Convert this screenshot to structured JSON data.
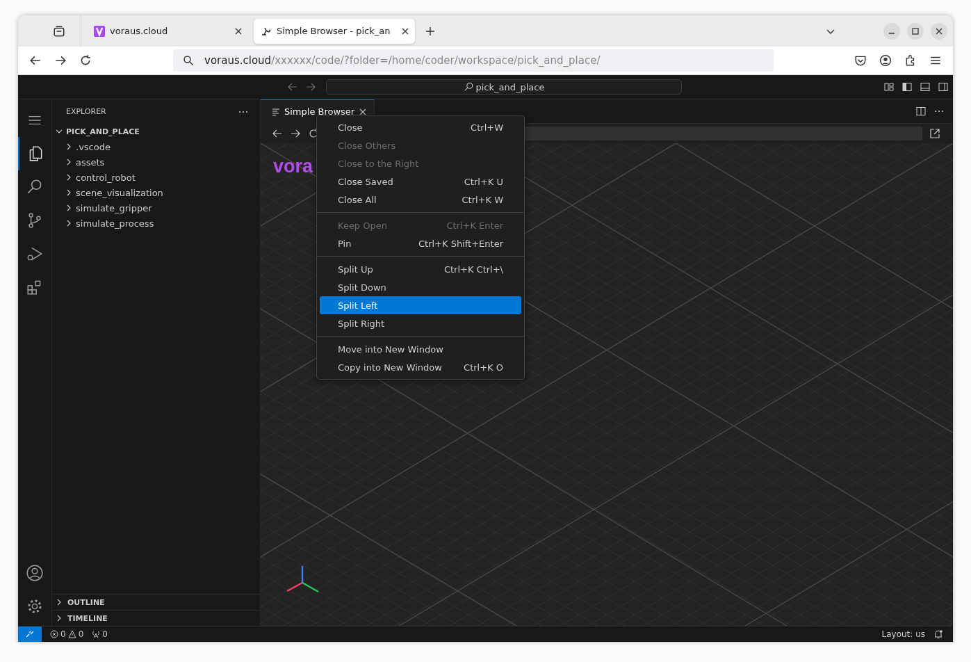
{
  "browser": {
    "tabs": [
      {
        "title": "voraus.cloud",
        "selected": false
      },
      {
        "title": "Simple Browser - pick_an",
        "selected": true
      }
    ],
    "url": {
      "host": "voraus.cloud",
      "path": "/xxxxxx/code/?folder=/home/coder/workspace/pick_and_place/"
    }
  },
  "titlebar": {
    "command_center": "pick_and_place"
  },
  "sidebar": {
    "title": "EXPLORER",
    "tree": [
      {
        "label": "PICK_AND_PLACE",
        "expanded": true,
        "children": [
          {
            "label": ".vscode",
            "expanded": false
          },
          {
            "label": "assets",
            "expanded": false
          },
          {
            "label": "control_robot",
            "expanded": false
          },
          {
            "label": "scene_visualization",
            "expanded": false
          },
          {
            "label": "simulate_gripper",
            "expanded": false
          },
          {
            "label": "simulate_process",
            "expanded": false
          }
        ]
      }
    ],
    "sections": [
      {
        "label": "OUTLINE",
        "expanded": false
      },
      {
        "label": "TIMELINE",
        "expanded": false
      }
    ]
  },
  "editor": {
    "tabs": [
      {
        "label": "Simple Browser",
        "selected": true
      }
    ],
    "page_logo": "vora"
  },
  "context_menu": {
    "groups": [
      [
        {
          "label": "Close",
          "shortcut": "Ctrl+W",
          "disabled": false,
          "selected": false
        },
        {
          "label": "Close Others",
          "disabled": true,
          "selected": false
        },
        {
          "label": "Close to the Right",
          "disabled": true,
          "selected": false
        },
        {
          "label": "Close Saved",
          "shortcut": "Ctrl+K U",
          "disabled": false,
          "selected": false
        },
        {
          "label": "Close All",
          "shortcut": "Ctrl+K W",
          "disabled": false,
          "selected": false
        }
      ],
      [
        {
          "label": "Keep Open",
          "shortcut": "Ctrl+K Enter",
          "disabled": true,
          "selected": false
        },
        {
          "label": "Pin",
          "shortcut": "Ctrl+K Shift+Enter",
          "disabled": false,
          "selected": false
        }
      ],
      [
        {
          "label": "Split Up",
          "shortcut": "Ctrl+K Ctrl+\\",
          "disabled": false,
          "selected": false
        },
        {
          "label": "Split Down",
          "disabled": false,
          "selected": false
        },
        {
          "label": "Split Left",
          "disabled": false,
          "selected": true
        },
        {
          "label": "Split Right",
          "disabled": false,
          "selected": false
        }
      ],
      [
        {
          "label": "Move into New Window",
          "disabled": false,
          "selected": false
        },
        {
          "label": "Copy into New Window",
          "shortcut": "Ctrl+K O",
          "disabled": false,
          "selected": false
        }
      ]
    ]
  },
  "status_bar": {
    "errors": "0",
    "warnings": "0",
    "ports": "0",
    "layout": "Layout: us"
  }
}
